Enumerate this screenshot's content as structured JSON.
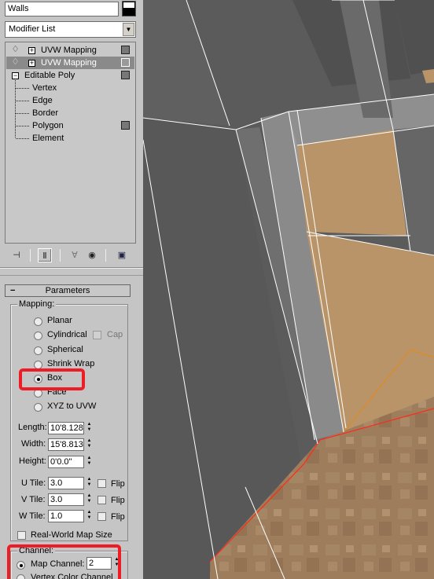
{
  "object_name": "Walls",
  "modifier_list": "Modifier List",
  "stack": [
    {
      "label": "UVW Mapping",
      "selected": false
    },
    {
      "label": "UVW Mapping",
      "selected": true
    },
    {
      "label": "Editable Poly",
      "selected": false
    }
  ],
  "subobjects": [
    "Vertex",
    "Edge",
    "Border",
    "Polygon",
    "Element"
  ],
  "parameters": {
    "title": "Parameters",
    "collapse": "−",
    "mapping_label": "Mapping:",
    "options": [
      "Planar",
      "Cylindrical",
      "Spherical",
      "Shrink Wrap",
      "Box",
      "Face",
      "XYZ to UVW"
    ],
    "cap_label": "Cap",
    "selected": "Box",
    "length_label": "Length:",
    "length": "10'8.128",
    "width_label": "Width:",
    "width": "15'8.813",
    "height_label": "Height:",
    "height": "0'0.0\"",
    "utile_label": "U Tile:",
    "utile": "3.0",
    "vtile_label": "V Tile:",
    "vtile": "3.0",
    "wtile_label": "W Tile:",
    "wtile": "1.0",
    "flip_label": "Flip",
    "realworld_label": "Real-World Map Size",
    "channel_label": "Channel:",
    "map_channel_label": "Map Channel:",
    "map_channel": "2",
    "vertex_color_label": "Vertex Color Channel"
  },
  "icons": {
    "pin": "pin-icon",
    "show_end_result": "show-end-result-icon",
    "make_unique": "make-unique-icon",
    "remove_modifier": "remove-modifier-icon",
    "configure_sets": "configure-modifier-sets-icon"
  },
  "colors": {
    "highlight": "#ee1c25",
    "wood": "#b89468",
    "floor": "#9c7a58",
    "viewport_bg": "#5b5b5b"
  }
}
